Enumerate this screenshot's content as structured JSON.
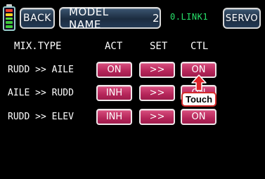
{
  "header": {
    "back_label": "BACK",
    "model_label": "MODEL NAME",
    "model_number": "2",
    "link_status": "0.LINK1",
    "servo_label": "SERVO"
  },
  "battery": {
    "segments": [
      "#f0412d",
      "#f7d320",
      "#5be03b",
      "#3ec83a",
      "#3ec83a"
    ]
  },
  "columns": {
    "mix_type": "MIX.TYPE",
    "act": "ACT",
    "set": "SET",
    "ctl": "CTL"
  },
  "rows": [
    {
      "label": "RUDD >> AILE",
      "act": "ON",
      "set": ">>",
      "ctl": "ON"
    },
    {
      "label": "AILE >> RUDD",
      "act": "INH",
      "set": ">>",
      "ctl": "ON"
    },
    {
      "label": "RUDD >> ELEV",
      "act": "INH",
      "set": ">>",
      "ctl": "ON"
    }
  ],
  "annotation": {
    "touch_label": "Touch",
    "arrow_color": "#e0242a"
  }
}
